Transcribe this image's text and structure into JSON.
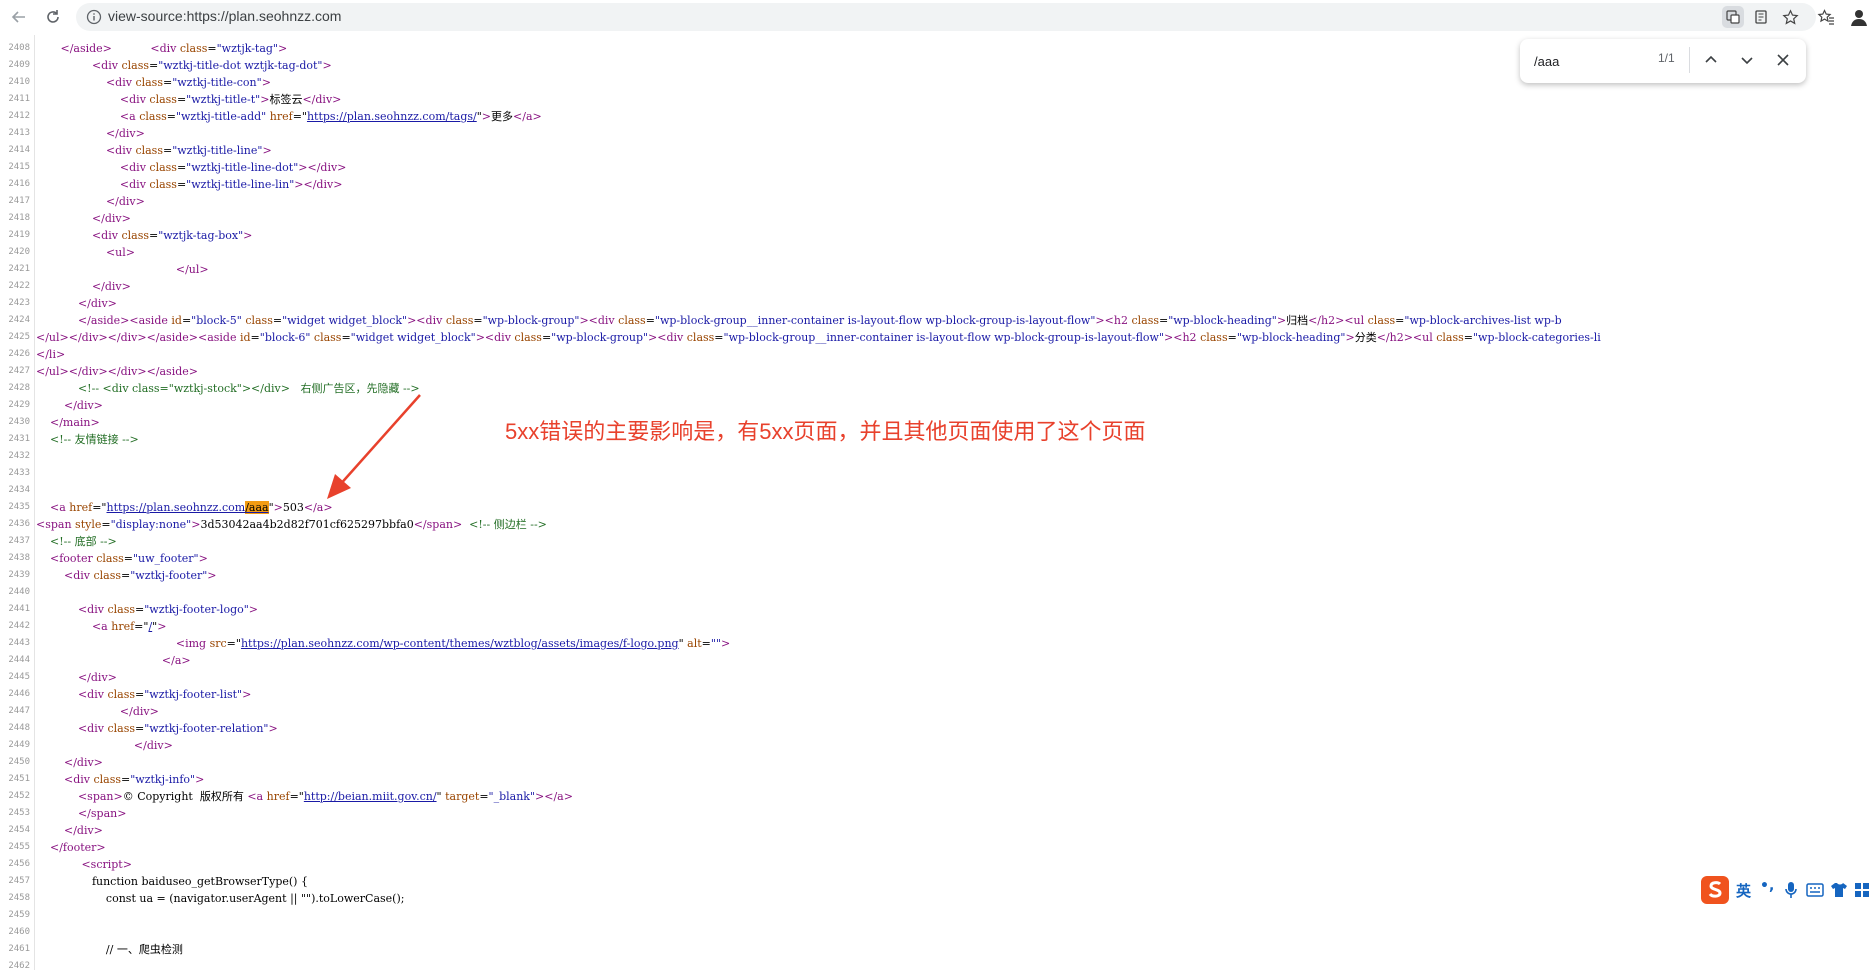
{
  "browser": {
    "address": "view-source:https://plan.seohnzz.com"
  },
  "find_bar": {
    "query": "/aaa",
    "count": "1/1"
  },
  "annotation": {
    "text": "5xx错误的主要影响是，有5xx页面，并且其他页面使用了这个页面"
  },
  "ime": {
    "lang": "英",
    "punct": "•,"
  },
  "source_lines": [
    {
      "num": "2408",
      "html": "       <span class=\"tag\">&lt;/aside&gt;</span>           <span class=\"tag\">&lt;div</span> <span class=\"attr\">class</span>=<span class=\"val\">\"wztjk-tag\"</span><span class=\"tag\">&gt;</span>"
    },
    {
      "num": "2409",
      "html": "                <span class=\"tag\">&lt;div</span> <span class=\"attr\">class</span>=<span class=\"val\">\"wztkj-title-dot wztjk-tag-dot\"</span><span class=\"tag\">&gt;</span>"
    },
    {
      "num": "2410",
      "html": "                    <span class=\"tag\">&lt;div</span> <span class=\"attr\">class</span>=<span class=\"val\">\"wztkj-title-con\"</span><span class=\"tag\">&gt;</span>"
    },
    {
      "num": "2411",
      "html": "                        <span class=\"tag\">&lt;div</span> <span class=\"attr\">class</span>=<span class=\"val\">\"wztkj-title-t\"</span><span class=\"tag\">&gt;</span>标签云<span class=\"tag\">&lt;/div&gt;</span>"
    },
    {
      "num": "2412",
      "html": "                        <span class=\"tag\">&lt;a</span> <span class=\"attr\">class</span>=<span class=\"val\">\"wztkj-title-add\"</span> <span class=\"attr\">href</span>=\"<span class=\"lnk\">https://plan.seohnzz.com/tags/</span>\"<span class=\"tag\">&gt;</span>更多<span class=\"tag\">&lt;/a&gt;</span>"
    },
    {
      "num": "2413",
      "html": "                    <span class=\"tag\">&lt;/div&gt;</span>"
    },
    {
      "num": "2414",
      "html": "                    <span class=\"tag\">&lt;div</span> <span class=\"attr\">class</span>=<span class=\"val\">\"wztkj-title-line\"</span><span class=\"tag\">&gt;</span>"
    },
    {
      "num": "2415",
      "html": "                        <span class=\"tag\">&lt;div</span> <span class=\"attr\">class</span>=<span class=\"val\">\"wztkj-title-line-dot\"</span><span class=\"tag\">&gt;&lt;/div&gt;</span>"
    },
    {
      "num": "2416",
      "html": "                        <span class=\"tag\">&lt;div</span> <span class=\"attr\">class</span>=<span class=\"val\">\"wztkj-title-line-lin\"</span><span class=\"tag\">&gt;&lt;/div&gt;</span>"
    },
    {
      "num": "2417",
      "html": "                    <span class=\"tag\">&lt;/div&gt;</span>"
    },
    {
      "num": "2418",
      "html": "                <span class=\"tag\">&lt;/div&gt;</span>"
    },
    {
      "num": "2419",
      "html": "                <span class=\"tag\">&lt;div</span> <span class=\"attr\">class</span>=<span class=\"val\">\"wztjk-tag-box\"</span><span class=\"tag\">&gt;</span>"
    },
    {
      "num": "2420",
      "html": "                    <span class=\"tag\">&lt;ul&gt;</span>"
    },
    {
      "num": "2421",
      "html": "                                        <span class=\"tag\">&lt;/ul&gt;</span>"
    },
    {
      "num": "2422",
      "html": "                <span class=\"tag\">&lt;/div&gt;</span>"
    },
    {
      "num": "2423",
      "html": "            <span class=\"tag\">&lt;/div&gt;</span>"
    },
    {
      "num": "2424",
      "html": "            <span class=\"tag\">&lt;/aside&gt;&lt;aside</span> <span class=\"attr\">id</span>=<span class=\"val\">\"block-5\"</span> <span class=\"attr\">class</span>=<span class=\"val\">\"widget widget_block\"</span><span class=\"tag\">&gt;&lt;div</span> <span class=\"attr\">class</span>=<span class=\"val\">\"wp-block-group\"</span><span class=\"tag\">&gt;&lt;div</span> <span class=\"attr\">class</span>=<span class=\"val\">\"wp-block-group__inner-container is-layout-flow wp-block-group-is-layout-flow\"</span><span class=\"tag\">&gt;&lt;h2</span> <span class=\"attr\">class</span>=<span class=\"val\">\"wp-block-heading\"</span><span class=\"tag\">&gt;</span>归档<span class=\"tag\">&lt;/h2&gt;&lt;ul</span> <span class=\"attr\">class</span>=<span class=\"val\">\"wp-block-archives-list wp-b</span>"
    },
    {
      "num": "2425",
      "html": "<span class=\"tag\">&lt;/ul&gt;&lt;/div&gt;&lt;/div&gt;&lt;/aside&gt;&lt;aside</span> <span class=\"attr\">id</span>=<span class=\"val\">\"block-6\"</span> <span class=\"attr\">class</span>=<span class=\"val\">\"widget widget_block\"</span><span class=\"tag\">&gt;&lt;div</span> <span class=\"attr\">class</span>=<span class=\"val\">\"wp-block-group\"</span><span class=\"tag\">&gt;&lt;div</span> <span class=\"attr\">class</span>=<span class=\"val\">\"wp-block-group__inner-container is-layout-flow wp-block-group-is-layout-flow\"</span><span class=\"tag\">&gt;&lt;h2</span> <span class=\"attr\">class</span>=<span class=\"val\">\"wp-block-heading\"</span><span class=\"tag\">&gt;</span>分类<span class=\"tag\">&lt;/h2&gt;&lt;ul</span> <span class=\"attr\">class</span>=<span class=\"val\">\"wp-block-categories-li</span>"
    },
    {
      "num": "2426",
      "html": "<span class=\"tag\">&lt;/li&gt;</span>"
    },
    {
      "num": "2427",
      "html": "<span class=\"tag\">&lt;/ul&gt;&lt;/div&gt;&lt;/div&gt;&lt;/aside&gt;</span>"
    },
    {
      "num": "2428",
      "html": "            <span class=\"cm\">&lt;!-- &lt;div class=\"wztkj-stock\"&gt;&lt;/div&gt;   右侧广告区，先隐藏 --&gt;</span>"
    },
    {
      "num": "2429",
      "html": "        <span class=\"tag\">&lt;/div&gt;</span>"
    },
    {
      "num": "2430",
      "html": "    <span class=\"tag\">&lt;/main&gt;</span>"
    },
    {
      "num": "2431",
      "html": "    <span class=\"cm\">&lt;!-- 友情链接 --&gt;</span>"
    },
    {
      "num": "2432",
      "html": ""
    },
    {
      "num": "2433",
      "html": ""
    },
    {
      "num": "2434",
      "html": ""
    },
    {
      "num": "2435",
      "html": "    <span class=\"tag\">&lt;a</span> <span class=\"attr\">href</span>=\"<span class=\"lnk\">https://plan.seohnzz.com<span class=\"hl\">/aaa</span></span>\"<span class=\"tag\">&gt;</span>503<span class=\"tag\">&lt;/a&gt;</span>"
    },
    {
      "num": "2436",
      "html": "<span class=\"tag\">&lt;span</span> <span class=\"attr\">style</span>=<span class=\"val\">\"display:none\"</span><span class=\"tag\">&gt;</span>3d53042aa4b2d82f701cf625297bbfa0<span class=\"tag\">&lt;/span&gt;</span>  <span class=\"cm\">&lt;!-- 侧边栏 --&gt;</span>"
    },
    {
      "num": "2437",
      "html": "    <span class=\"cm\">&lt;!-- 底部 --&gt;</span>"
    },
    {
      "num": "2438",
      "html": "    <span class=\"tag\">&lt;footer</span> <span class=\"attr\">class</span>=<span class=\"val\">\"uw_footer\"</span><span class=\"tag\">&gt;</span>"
    },
    {
      "num": "2439",
      "html": "        <span class=\"tag\">&lt;div</span> <span class=\"attr\">class</span>=<span class=\"val\">\"wztkj-footer\"</span><span class=\"tag\">&gt;</span>"
    },
    {
      "num": "2440",
      "html": ""
    },
    {
      "num": "2441",
      "html": "            <span class=\"tag\">&lt;div</span> <span class=\"attr\">class</span>=<span class=\"val\">\"wztkj-footer-logo\"</span><span class=\"tag\">&gt;</span>"
    },
    {
      "num": "2442",
      "html": "                <span class=\"tag\">&lt;a</span> <span class=\"attr\">href</span>=\"<span class=\"lnk\">/</span>\"<span class=\"tag\">&gt;</span>"
    },
    {
      "num": "2443",
      "html": "                                        <span class=\"tag\">&lt;img</span> <span class=\"attr\">src</span>=\"<span class=\"lnk\">https://plan.seohnzz.com/wp-content/themes/wztblog/assets/images/f-logo.png</span>\" <span class=\"attr\">alt</span>=<span class=\"val\">\"\"</span><span class=\"tag\">&gt;</span>"
    },
    {
      "num": "2444",
      "html": "                                    <span class=\"tag\">&lt;/a&gt;</span>"
    },
    {
      "num": "2445",
      "html": "            <span class=\"tag\">&lt;/div&gt;</span>"
    },
    {
      "num": "2446",
      "html": "            <span class=\"tag\">&lt;div</span> <span class=\"attr\">class</span>=<span class=\"val\">\"wztkj-footer-list\"</span><span class=\"tag\">&gt;</span>"
    },
    {
      "num": "2447",
      "html": "                        <span class=\"tag\">&lt;/div&gt;</span>"
    },
    {
      "num": "2448",
      "html": "            <span class=\"tag\">&lt;div</span> <span class=\"attr\">class</span>=<span class=\"val\">\"wztkj-footer-relation\"</span><span class=\"tag\">&gt;</span>"
    },
    {
      "num": "2449",
      "html": "                            <span class=\"tag\">&lt;/div&gt;</span>"
    },
    {
      "num": "2450",
      "html": "        <span class=\"tag\">&lt;/div&gt;</span>"
    },
    {
      "num": "2451",
      "html": "        <span class=\"tag\">&lt;div</span> <span class=\"attr\">class</span>=<span class=\"val\">\"wztkj-info\"</span><span class=\"tag\">&gt;</span>"
    },
    {
      "num": "2452",
      "html": "            <span class=\"tag\">&lt;span&gt;</span>© Copyright  版权所有 <span class=\"tag\">&lt;a</span> <span class=\"attr\">href</span>=\"<span class=\"lnk\">http://beian.miit.gov.cn/</span>\" <span class=\"attr\">target</span>=<span class=\"val\">\"_blank\"</span><span class=\"tag\">&gt;&lt;/a&gt;</span>"
    },
    {
      "num": "2453",
      "html": "            <span class=\"tag\">&lt;/span&gt;</span>"
    },
    {
      "num": "2454",
      "html": "        <span class=\"tag\">&lt;/div&gt;</span>"
    },
    {
      "num": "2455",
      "html": "    <span class=\"tag\">&lt;/footer&gt;</span>"
    },
    {
      "num": "2456",
      "html": "             <span class=\"tag\">&lt;script&gt;</span>"
    },
    {
      "num": "2457",
      "html": "                function baiduseo_getBrowserType() {"
    },
    {
      "num": "2458",
      "html": "                    const ua = (navigator.userAgent || \"\").toLowerCase();"
    },
    {
      "num": "2459",
      "html": ""
    },
    {
      "num": "2460",
      "html": ""
    },
    {
      "num": "2461",
      "html": "                    // 一、爬虫检测"
    },
    {
      "num": "2462",
      "html": ""
    }
  ]
}
